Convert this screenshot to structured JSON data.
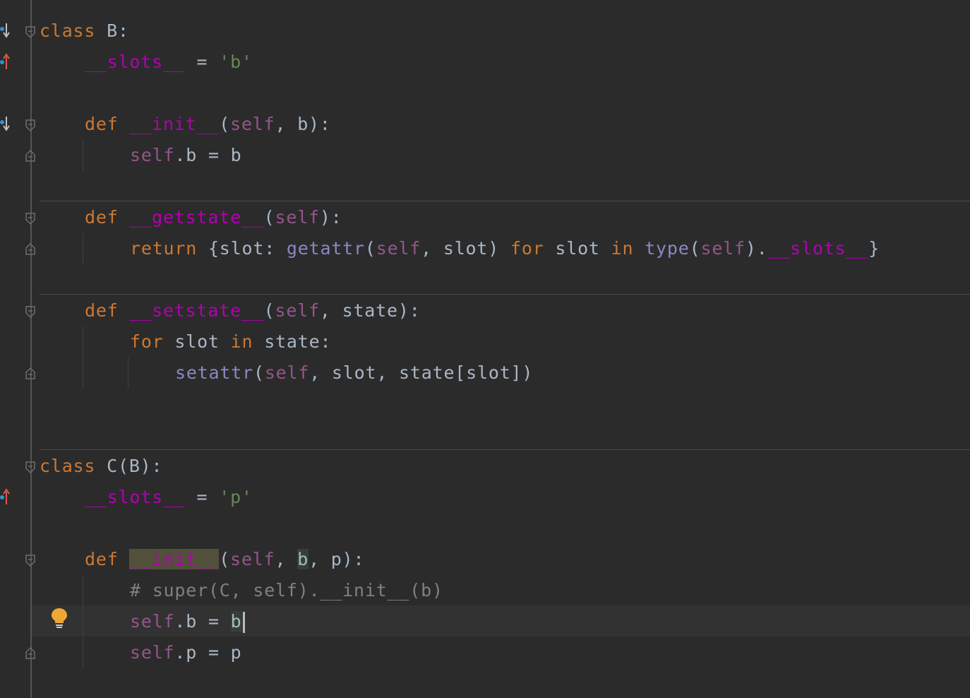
{
  "editor": {
    "language": "Python",
    "gutter_icons": [
      "overrides-down-icon",
      "overrides-up-icon",
      "overrides-down-icon",
      "overrides-up-icon",
      "lightbulb-icon"
    ],
    "colors": {
      "background": "#2b2b2b",
      "keyword": "#cc7832",
      "magic": "#b200b2",
      "self": "#94558d",
      "string": "#6a8759",
      "builtin": "#8888c6",
      "comment": "#808080",
      "plain": "#a9b7c6"
    }
  },
  "code": {
    "l1": {
      "kw": "class",
      "rest": " B:"
    },
    "l2": {
      "magic": "__slots__",
      "eq": " = ",
      "str": "'b'"
    },
    "l4": {
      "kw": "def",
      "magic": "__init__",
      "p1": "(",
      "self": "self",
      "rest": ", b):"
    },
    "l5": {
      "self": "self",
      "rest": ".b = b"
    },
    "l7": {
      "kw": "def",
      "magic": "__getstate__",
      "p1": "(",
      "self": "self",
      "rest": "):"
    },
    "l8": {
      "kw1": "return",
      "a": " {slot: ",
      "blt1": "getattr",
      "b": "(",
      "self1": "self",
      "c": ", slot) ",
      "kw2": "for",
      "d": " slot ",
      "kw3": "in",
      "e": " ",
      "blt2": "type",
      "f": "(",
      "self2": "self",
      "g": ").",
      "magic": "__slots__",
      "h": "}"
    },
    "l10": {
      "kw": "def",
      "magic": "__setstate__",
      "p1": "(",
      "self": "self",
      "rest": ", state):"
    },
    "l11": {
      "kw1": "for",
      "a": " slot ",
      "kw2": "in",
      "b": " state:"
    },
    "l12": {
      "blt": "setattr",
      "a": "(",
      "self": "self",
      "b": ", slot, state[slot])"
    },
    "l15": {
      "kw": "class",
      "rest": " C(B):"
    },
    "l16": {
      "magic": "__slots__",
      "eq": " = ",
      "str": "'p'"
    },
    "l18": {
      "kw": "def",
      "magic": "__init__",
      "a": "(",
      "self": "self",
      "b": ", ",
      "arg": "b",
      "c": ", p):"
    },
    "l19": {
      "cmt": "# super(C, self).__init__(b)"
    },
    "l20": {
      "self": "self",
      "a": ".b = ",
      "b": "b"
    },
    "l21": {
      "self": "self",
      "rest": ".p = p"
    }
  }
}
